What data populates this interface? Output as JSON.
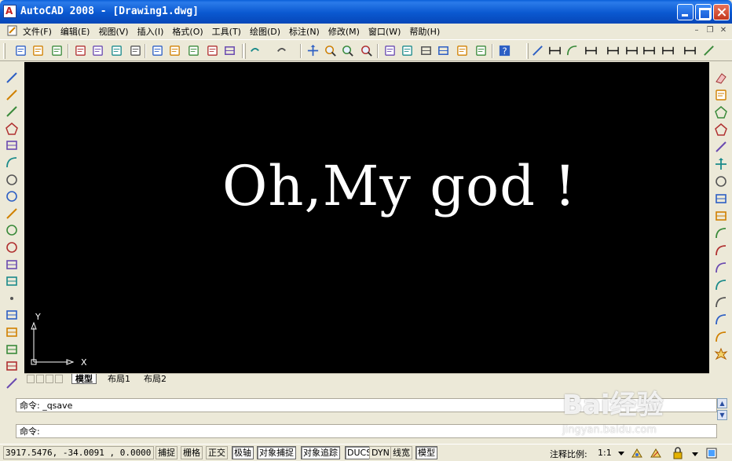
{
  "window": {
    "title": "AutoCAD 2008 - [Drawing1.dwg]"
  },
  "menu": {
    "items": [
      "文件(F)",
      "编辑(E)",
      "视图(V)",
      "插入(I)",
      "格式(O)",
      "工具(T)",
      "绘图(D)",
      "标注(N)",
      "修改(M)",
      "窗口(W)",
      "帮助(H)"
    ]
  },
  "toolbar": {
    "standard_icons": [
      "new-icon",
      "open-icon",
      "save-icon",
      "plot-icon",
      "plot-preview-icon",
      "publish-icon",
      "3d-dwf-icon",
      "cut-icon",
      "copy-icon",
      "paste-icon",
      "match-properties-icon",
      "block-editor-icon",
      "undo-icon",
      "redo-icon",
      "pan-icon",
      "zoom-realtime-icon",
      "zoom-window-icon",
      "zoom-previous-icon",
      "properties-icon",
      "design-center-icon",
      "tool-palettes-icon",
      "sheet-set-icon",
      "markup-icon",
      "quickcalc-icon",
      "help-icon"
    ],
    "dimension_icons": [
      "linear-dim-icon",
      "aligned-dim-icon",
      "arc-length-icon",
      "ordinate-icon",
      "radius-icon",
      "jogged-icon",
      "diameter-icon",
      "angular-icon",
      "quick-dim-icon",
      "baseline-icon"
    ]
  },
  "draw_toolbar": [
    "line-icon",
    "construction-line-icon",
    "polyline-icon",
    "polygon-icon",
    "rectangle-icon",
    "arc-icon",
    "circle-icon",
    "revision-cloud-icon",
    "spline-icon",
    "ellipse-icon",
    "ellipse-arc-icon",
    "insert-block-icon",
    "make-block-icon",
    "point-icon",
    "hatch-icon",
    "gradient-icon",
    "region-icon",
    "table-icon",
    "multiline-text-icon"
  ],
  "modify_toolbar": [
    "erase-icon",
    "copy-object-icon",
    "mirror-icon",
    "offset-icon",
    "array-icon",
    "move-icon",
    "rotate-icon",
    "scale-icon",
    "stretch-icon",
    "trim-icon",
    "extend-icon",
    "break-at-point-icon",
    "break-icon",
    "join-icon",
    "chamfer-icon",
    "fillet-icon",
    "explode-icon"
  ],
  "canvas": {
    "text": "Oh,My god !",
    "ucs_y": "Y",
    "ucs_x": "X",
    "background": "#000000"
  },
  "layout_tabs": {
    "tabs": [
      "模型",
      "布局1",
      "布局2"
    ],
    "active": "模型"
  },
  "command": {
    "history_line": "命令: _qsave",
    "prompt": "命令:"
  },
  "watermark": {
    "brand": "Bai经验",
    "url": "jingyan.baidu.com"
  },
  "status": {
    "coordinates": "3917.5476, -34.0091 , 0.0000",
    "buttons": [
      {
        "label": "捕捉",
        "on": false
      },
      {
        "label": "栅格",
        "on": false
      },
      {
        "label": "正交",
        "on": false
      },
      {
        "label": "极轴",
        "on": true
      },
      {
        "label": "对象捕捉",
        "on": true
      },
      {
        "label": "对象追踪",
        "on": true
      },
      {
        "label": "DUCS",
        "on": true
      },
      {
        "label": "DYN",
        "on": false
      },
      {
        "label": "线宽",
        "on": false
      },
      {
        "label": "模型",
        "on": true
      }
    ],
    "annotation_scale_label": "注释比例:",
    "annotation_scale_value": "1:1"
  }
}
